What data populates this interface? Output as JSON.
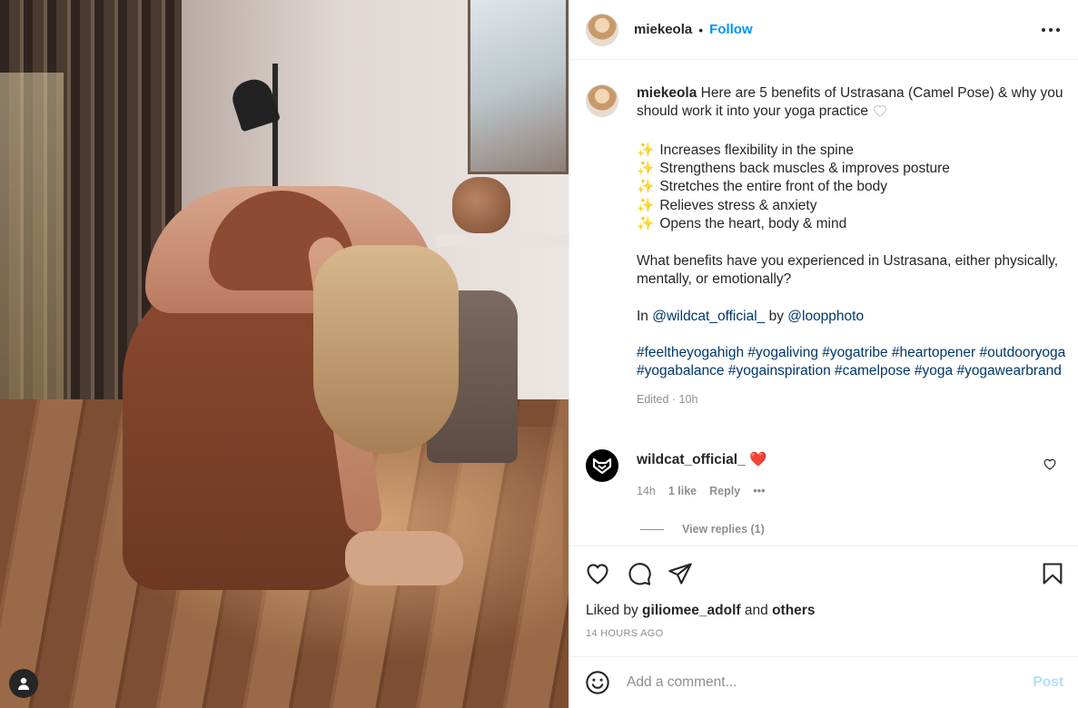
{
  "post": {
    "author": "miekeola",
    "separator": "•",
    "follow_label": "Follow",
    "more_icon": "more-options-icon"
  },
  "caption": {
    "author": "miekeola",
    "intro": "Here are 5 benefits of Ustrasana (Camel Pose) & why you should work it into your yoga practice",
    "bullet": "✨",
    "benefits": [
      "Increases flexibility in the spine",
      "Strengthens back muscles & improves posture",
      "Stretches the entire front of the body",
      "Relieves stress & anxiety",
      "Opens the heart, body & mind"
    ],
    "question": "What benefits have you experienced in Ustrasana, either physically, mentally, or emotionally?",
    "credit_prefix": "In",
    "credit_brand": "@wildcat_official_",
    "credit_by": "by",
    "credit_photographer": "@loopphoto",
    "hashtags": "#feeltheyogahigh #yogaliving #yogatribe #heartopener #outdooryoga #yogabalance #yogainspiration #camelpose #yoga #yogawearbrand",
    "meta": "Edited · 10h"
  },
  "comment": {
    "author": "wildcat_official_",
    "emoji": "❤️",
    "age": "14h",
    "likes": "1 like",
    "reply_label": "Reply",
    "more": "•••",
    "view_replies": "View replies (1)"
  },
  "engagement": {
    "liked_by_prefix": "Liked by",
    "liked_by_user": "giliomee_adolf",
    "liked_by_and": "and",
    "liked_by_others": "others",
    "timestamp": "14 HOURS AGO"
  },
  "composer": {
    "placeholder": "Add a comment...",
    "post_label": "Post"
  },
  "colors": {
    "accent": "#0095f6",
    "link": "#00376b",
    "muted": "#8e8e8e",
    "post_disabled": "#b2dffc"
  }
}
